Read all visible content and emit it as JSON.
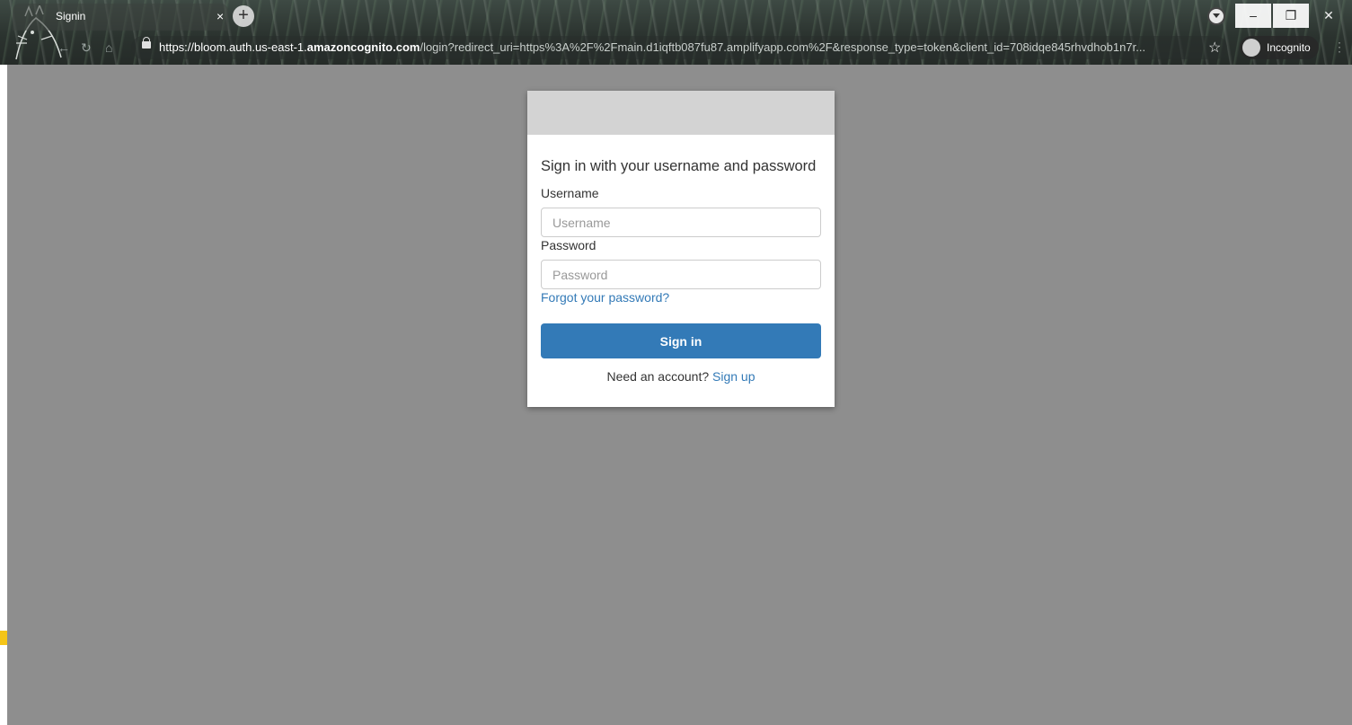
{
  "browser": {
    "tab_title": "Signin",
    "tab_close": "×",
    "new_tab": "+",
    "url_host": "https://bloom.auth.us-east-1.",
    "url_domain": "amazoncognito.com",
    "url_path": "/login?redirect_uri=https%3A%2F%2Fmain.d1iqftb087fu87.amplifyapp.com%2F&response_type=token&client_id=708idqe845rhvdhob1n7r...",
    "incognito_label": "Incognito",
    "window_controls": {
      "minimize": "–",
      "maximize": "❐",
      "close": "✕"
    },
    "icons": [
      "back-icon",
      "refresh-icon",
      "home-icon",
      "lock-icon",
      "star-icon",
      "incognito-icon",
      "menu-icon",
      "extension-icon"
    ]
  },
  "login": {
    "heading": "Sign in with your username and password",
    "username_label": "Username",
    "username_placeholder": "Username",
    "username_value": "",
    "password_label": "Password",
    "password_placeholder": "Password",
    "password_value": "",
    "forgot_link": "Forgot your password?",
    "submit_label": "Sign in",
    "signup_prompt": "Need an account?",
    "signup_link": "Sign up"
  },
  "colors": {
    "page_background": "#8e8e8e",
    "banner": "#d3d3d3",
    "primary": "#337ab7",
    "text": "#333333"
  }
}
